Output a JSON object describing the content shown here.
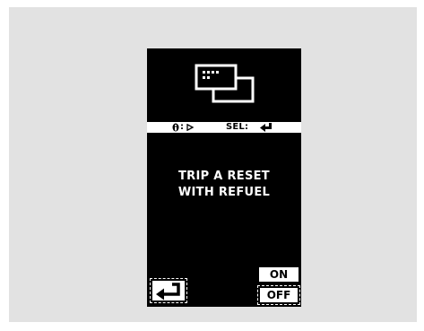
{
  "display": {
    "status_bar": {
      "info_separator": ":",
      "select_label": "SEL:"
    },
    "message": {
      "line1": "TRIP A RESET",
      "line2": "WITH REFUEL"
    },
    "options": {
      "on_label": "ON",
      "off_label": "OFF"
    }
  },
  "icons": {
    "top": "windows-icon",
    "info": "info-icon",
    "play": "play-icon",
    "enter": "enter-icon",
    "back": "back-arrow-icon"
  },
  "colors": {
    "background_panel": "#e2e2e2",
    "screen": "#000000",
    "foreground": "#ffffff"
  }
}
